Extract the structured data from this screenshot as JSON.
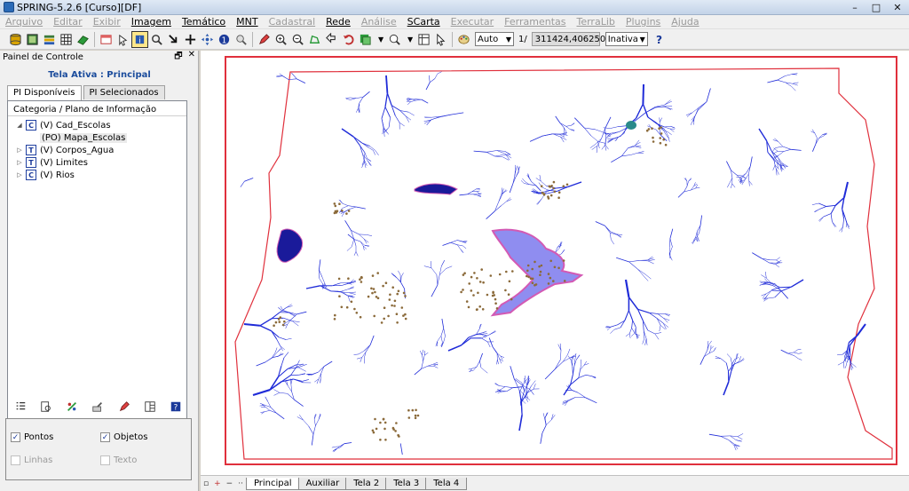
{
  "window": {
    "title": "SPRING-5.2.6 [Curso][DF]",
    "controls": [
      "–",
      "□",
      "✕"
    ]
  },
  "menu": [
    {
      "label": "Arquivo",
      "enabled": false
    },
    {
      "label": "Editar",
      "enabled": false
    },
    {
      "label": "Exibir",
      "enabled": false
    },
    {
      "label": "Imagem",
      "enabled": true
    },
    {
      "label": "Temático",
      "enabled": true
    },
    {
      "label": "MNT",
      "enabled": true
    },
    {
      "label": "Cadastral",
      "enabled": false
    },
    {
      "label": "Rede",
      "enabled": true
    },
    {
      "label": "Análise",
      "enabled": false
    },
    {
      "label": "SCarta",
      "enabled": true
    },
    {
      "label": "Executar",
      "enabled": false
    },
    {
      "label": "Ferramentas",
      "enabled": false
    },
    {
      "label": "TerraLib",
      "enabled": false
    },
    {
      "label": "Plugins",
      "enabled": false
    },
    {
      "label": "Ajuda",
      "enabled": false
    }
  ],
  "toolbar": {
    "scale_mode": "Auto",
    "scale_prefix": "1/",
    "scale_value": "311424,406250",
    "cursor_mode": "Inativa"
  },
  "panel": {
    "title": "Painel de Controle",
    "header_controls": [
      "🗗",
      "✕"
    ],
    "active_screen": "Tela Ativa : Principal",
    "tabs": [
      "PI Disponíveis",
      "PI Selecionados"
    ],
    "tree_header": "Categoria / Plano de Informação",
    "tree": [
      {
        "type": "C",
        "label": "(V) Cad_Escolas",
        "expanded": true
      },
      {
        "label": "(PO) Mapa_Escolas",
        "child": true
      },
      {
        "type": "T",
        "label": "(V) Corpos_Agua",
        "expanded": false
      },
      {
        "type": "T",
        "label": "(V) Limites",
        "expanded": false
      },
      {
        "type": "C",
        "label": "(V) Rios",
        "expanded": false
      }
    ],
    "options": {
      "pontos": {
        "label": "Pontos",
        "checked": true
      },
      "objetos": {
        "label": "Objetos",
        "checked": true
      },
      "linhas": {
        "label": "Linhas",
        "checked": false
      },
      "texto": {
        "label": "Texto",
        "checked": false
      }
    }
  },
  "workspace_tabs": [
    "Principal",
    "Auxiliar",
    "Tela 2",
    "Tela 3",
    "Tela 4"
  ],
  "workspace_tab_active": "Principal",
  "colors": {
    "rivers": "#1f2bd8",
    "boundary": "#e0303c",
    "lake": "#8f8df0",
    "lake_edge": "#d35ab4",
    "schools": "#8b6a3a"
  }
}
